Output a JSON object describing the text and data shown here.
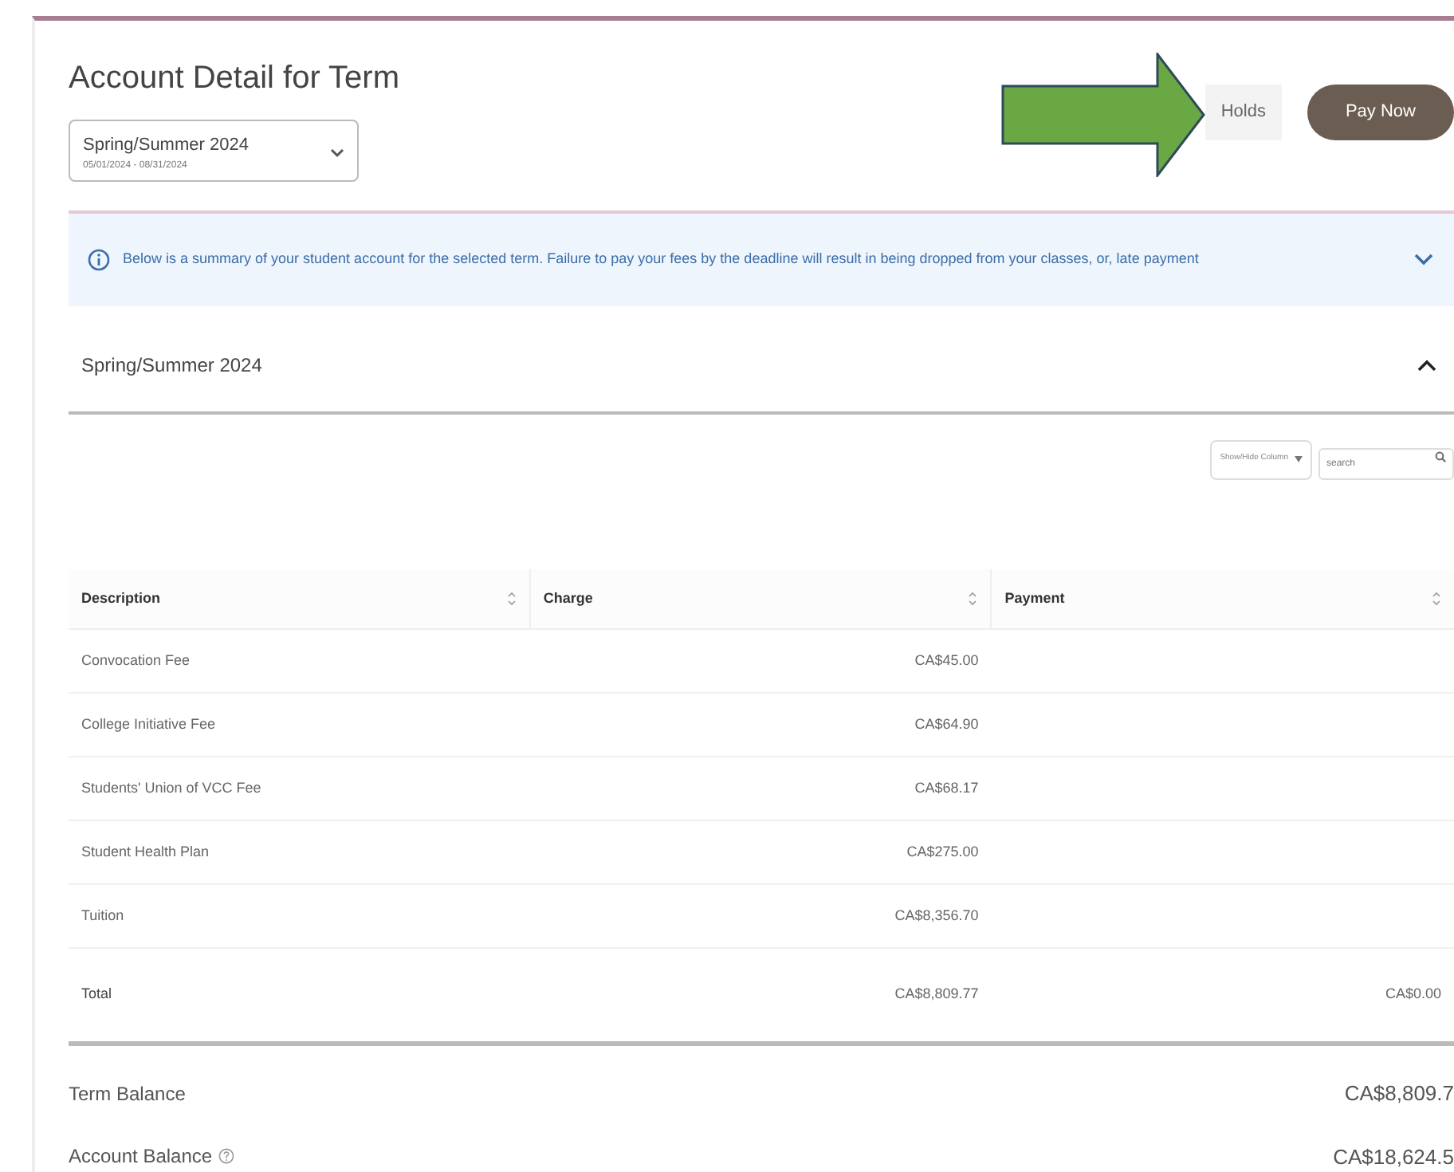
{
  "page": {
    "title": "Account Detail for Term"
  },
  "buttons": [
    {
      "label": "Holds",
      "kind": "secondary"
    },
    {
      "label": "Pay Now",
      "kind": "primary"
    }
  ],
  "term_select": {
    "value": "Spring/Summer 2024",
    "dates": "05/01/2024 - 08/31/2024"
  },
  "notice": {
    "text": "Below is a summary of your student account for the selected term. Failure to pay your fees by the deadline will result in being dropped from your classes, or, late payment",
    "expanded": false
  },
  "section": {
    "title": "Spring/Summer 2024",
    "expanded": true
  },
  "toolbar": {
    "column_toggle": "Show/Hide Column",
    "search": {
      "placeholder": "search"
    }
  },
  "table": {
    "columns": [
      "Description",
      "Charge",
      "Payment"
    ],
    "rows": [
      {
        "description": "Convocation Fee",
        "charge": "CA$45.00"
      },
      {
        "description": "College Initiative Fee",
        "charge": "CA$64.90"
      },
      {
        "description": "Students' Union of VCC Fee",
        "charge": "CA$68.17"
      },
      {
        "description": "Student Health Plan",
        "charge": "CA$275.00"
      },
      {
        "description": "Tuition",
        "charge": "CA$8,356.70"
      }
    ],
    "total": {
      "description": "Total",
      "charge": "CA$8,809.77",
      "payment": "CA$0.00"
    }
  },
  "balances": [
    {
      "label": "Term Balance",
      "value": "CA$8,809.7",
      "help": false
    },
    {
      "label": "Account Balance",
      "value": "CA$18,624.5",
      "help": true
    }
  ]
}
